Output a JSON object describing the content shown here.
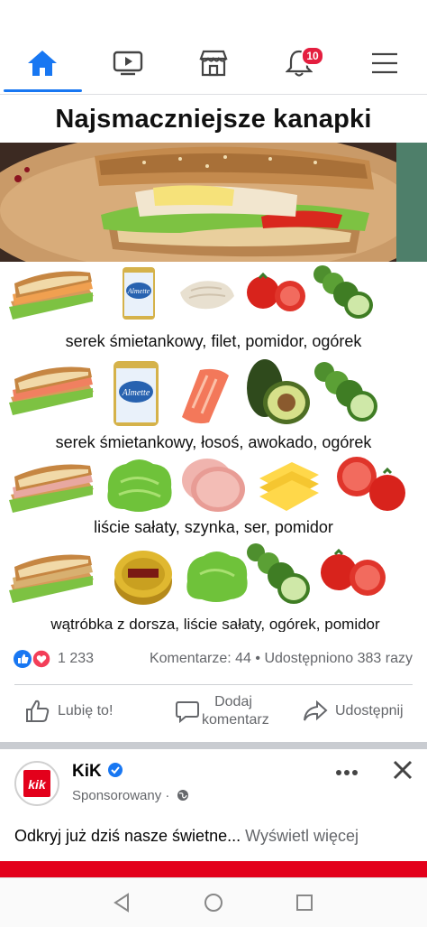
{
  "nav": {
    "notifications_count": "10"
  },
  "post": {
    "title": "Najsmaczniejsze kanapki",
    "captions": [
      "serek śmietankowy, filet, pomidor, ogórek",
      "serek śmietankowy, łosoś, awokado, ogórek",
      "liście sałaty, szynka, ser, pomidor",
      "wątróbka z dorsza, liście sałaty, ogórek, pomidor"
    ],
    "brand_label": "Almette"
  },
  "reactions": {
    "count": "1 233",
    "comments": "Komentarze: 44",
    "shares": "Udostępniono 383 razy",
    "separator": "•"
  },
  "actions": {
    "like": "Lubię to!",
    "comment": "Dodaj komentarz",
    "share": "Udostępnij"
  },
  "ad": {
    "name": "KiK",
    "logo_text": "kik",
    "sponsored": "Sponsorowany ·",
    "text": "Odkryj już dziś nasze świetne...",
    "more": "Wyświetl więcej"
  },
  "colors": {
    "accent": "#1877f2",
    "badge": "#e41e3f",
    "brand_red": "#e3001b"
  }
}
